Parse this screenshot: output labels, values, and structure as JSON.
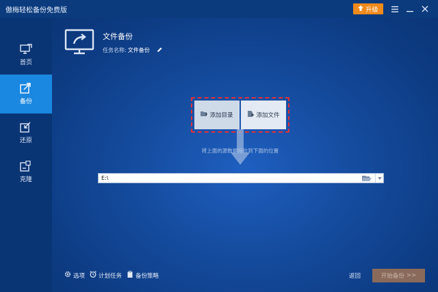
{
  "app": {
    "title": "傲梅轻松备份免费版"
  },
  "titlebar": {
    "upgrade_label": "升级",
    "upgrade_color": "#f08a1c",
    "menu_icon": "hamburger-menu-icon",
    "minimize_icon": "minimize-icon",
    "close_icon": "close-icon"
  },
  "sidebar": {
    "items": [
      {
        "label": "首页",
        "icon": "home-monitor-icon",
        "active": false
      },
      {
        "label": "备份",
        "icon": "backup-export-icon",
        "active": true
      },
      {
        "label": "还原",
        "icon": "restore-icon",
        "active": false
      },
      {
        "label": "克隆",
        "icon": "clone-icon",
        "active": false
      }
    ],
    "active_color": "#1a87e0"
  },
  "header": {
    "icon": "file-backup-monitor-icon",
    "title": "文件备份",
    "task_label": "任务名称:",
    "task_value": "文件备份",
    "edit_icon": "pencil-icon"
  },
  "source": {
    "add_folder_label": "添加目录",
    "add_file_label": "添加文件",
    "highlight_color": "#e0313a"
  },
  "drop_hint": "将上面的源数据拖拉到下面的位置",
  "destination": {
    "path_value": "E:\\",
    "browse_icon": "folder-open-icon",
    "dropdown_icon": "chevron-down-icon"
  },
  "footer": {
    "options_label": "选项",
    "schedule_label": "计划任务",
    "scheme_label": "备份策略",
    "back_label": "返回",
    "start_label": "开始备份",
    "start_suffix": ">>"
  }
}
